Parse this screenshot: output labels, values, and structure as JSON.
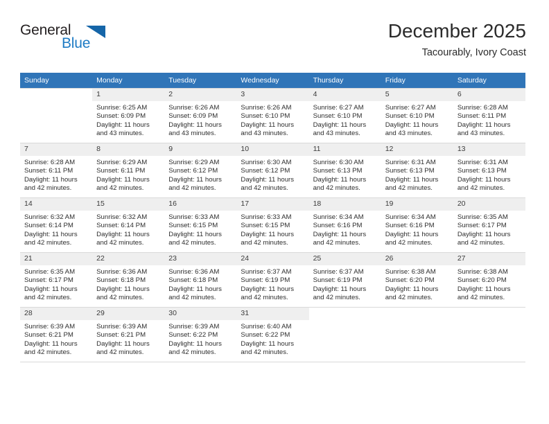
{
  "brand": {
    "name_top": "General",
    "name_bottom": "Blue",
    "accent_color": "#1e7bc4",
    "triangle_color": "#1565a8"
  },
  "header": {
    "month_title": "December 2025",
    "location": "Tacourably, Ivory Coast"
  },
  "calendar": {
    "header_color": "#3075b8",
    "daynum_band_color": "#efefef",
    "weekday_headers": [
      "Sunday",
      "Monday",
      "Tuesday",
      "Wednesday",
      "Thursday",
      "Friday",
      "Saturday"
    ],
    "weeks": [
      [
        {
          "day": "",
          "blank": true,
          "lines": []
        },
        {
          "day": "1",
          "lines": [
            "Sunrise: 6:25 AM",
            "Sunset: 6:09 PM",
            "Daylight: 11 hours",
            "and 43 minutes."
          ]
        },
        {
          "day": "2",
          "lines": [
            "Sunrise: 6:26 AM",
            "Sunset: 6:09 PM",
            "Daylight: 11 hours",
            "and 43 minutes."
          ]
        },
        {
          "day": "3",
          "lines": [
            "Sunrise: 6:26 AM",
            "Sunset: 6:10 PM",
            "Daylight: 11 hours",
            "and 43 minutes."
          ]
        },
        {
          "day": "4",
          "lines": [
            "Sunrise: 6:27 AM",
            "Sunset: 6:10 PM",
            "Daylight: 11 hours",
            "and 43 minutes."
          ]
        },
        {
          "day": "5",
          "lines": [
            "Sunrise: 6:27 AM",
            "Sunset: 6:10 PM",
            "Daylight: 11 hours",
            "and 43 minutes."
          ]
        },
        {
          "day": "6",
          "lines": [
            "Sunrise: 6:28 AM",
            "Sunset: 6:11 PM",
            "Daylight: 11 hours",
            "and 43 minutes."
          ]
        }
      ],
      [
        {
          "day": "7",
          "lines": [
            "Sunrise: 6:28 AM",
            "Sunset: 6:11 PM",
            "Daylight: 11 hours",
            "and 42 minutes."
          ]
        },
        {
          "day": "8",
          "lines": [
            "Sunrise: 6:29 AM",
            "Sunset: 6:11 PM",
            "Daylight: 11 hours",
            "and 42 minutes."
          ]
        },
        {
          "day": "9",
          "lines": [
            "Sunrise: 6:29 AM",
            "Sunset: 6:12 PM",
            "Daylight: 11 hours",
            "and 42 minutes."
          ]
        },
        {
          "day": "10",
          "lines": [
            "Sunrise: 6:30 AM",
            "Sunset: 6:12 PM",
            "Daylight: 11 hours",
            "and 42 minutes."
          ]
        },
        {
          "day": "11",
          "lines": [
            "Sunrise: 6:30 AM",
            "Sunset: 6:13 PM",
            "Daylight: 11 hours",
            "and 42 minutes."
          ]
        },
        {
          "day": "12",
          "lines": [
            "Sunrise: 6:31 AM",
            "Sunset: 6:13 PM",
            "Daylight: 11 hours",
            "and 42 minutes."
          ]
        },
        {
          "day": "13",
          "lines": [
            "Sunrise: 6:31 AM",
            "Sunset: 6:13 PM",
            "Daylight: 11 hours",
            "and 42 minutes."
          ]
        }
      ],
      [
        {
          "day": "14",
          "lines": [
            "Sunrise: 6:32 AM",
            "Sunset: 6:14 PM",
            "Daylight: 11 hours",
            "and 42 minutes."
          ]
        },
        {
          "day": "15",
          "lines": [
            "Sunrise: 6:32 AM",
            "Sunset: 6:14 PM",
            "Daylight: 11 hours",
            "and 42 minutes."
          ]
        },
        {
          "day": "16",
          "lines": [
            "Sunrise: 6:33 AM",
            "Sunset: 6:15 PM",
            "Daylight: 11 hours",
            "and 42 minutes."
          ]
        },
        {
          "day": "17",
          "lines": [
            "Sunrise: 6:33 AM",
            "Sunset: 6:15 PM",
            "Daylight: 11 hours",
            "and 42 minutes."
          ]
        },
        {
          "day": "18",
          "lines": [
            "Sunrise: 6:34 AM",
            "Sunset: 6:16 PM",
            "Daylight: 11 hours",
            "and 42 minutes."
          ]
        },
        {
          "day": "19",
          "lines": [
            "Sunrise: 6:34 AM",
            "Sunset: 6:16 PM",
            "Daylight: 11 hours",
            "and 42 minutes."
          ]
        },
        {
          "day": "20",
          "lines": [
            "Sunrise: 6:35 AM",
            "Sunset: 6:17 PM",
            "Daylight: 11 hours",
            "and 42 minutes."
          ]
        }
      ],
      [
        {
          "day": "21",
          "lines": [
            "Sunrise: 6:35 AM",
            "Sunset: 6:17 PM",
            "Daylight: 11 hours",
            "and 42 minutes."
          ]
        },
        {
          "day": "22",
          "lines": [
            "Sunrise: 6:36 AM",
            "Sunset: 6:18 PM",
            "Daylight: 11 hours",
            "and 42 minutes."
          ]
        },
        {
          "day": "23",
          "lines": [
            "Sunrise: 6:36 AM",
            "Sunset: 6:18 PM",
            "Daylight: 11 hours",
            "and 42 minutes."
          ]
        },
        {
          "day": "24",
          "lines": [
            "Sunrise: 6:37 AM",
            "Sunset: 6:19 PM",
            "Daylight: 11 hours",
            "and 42 minutes."
          ]
        },
        {
          "day": "25",
          "lines": [
            "Sunrise: 6:37 AM",
            "Sunset: 6:19 PM",
            "Daylight: 11 hours",
            "and 42 minutes."
          ]
        },
        {
          "day": "26",
          "lines": [
            "Sunrise: 6:38 AM",
            "Sunset: 6:20 PM",
            "Daylight: 11 hours",
            "and 42 minutes."
          ]
        },
        {
          "day": "27",
          "lines": [
            "Sunrise: 6:38 AM",
            "Sunset: 6:20 PM",
            "Daylight: 11 hours",
            "and 42 minutes."
          ]
        }
      ],
      [
        {
          "day": "28",
          "lines": [
            "Sunrise: 6:39 AM",
            "Sunset: 6:21 PM",
            "Daylight: 11 hours",
            "and 42 minutes."
          ]
        },
        {
          "day": "29",
          "lines": [
            "Sunrise: 6:39 AM",
            "Sunset: 6:21 PM",
            "Daylight: 11 hours",
            "and 42 minutes."
          ]
        },
        {
          "day": "30",
          "lines": [
            "Sunrise: 6:39 AM",
            "Sunset: 6:22 PM",
            "Daylight: 11 hours",
            "and 42 minutes."
          ]
        },
        {
          "day": "31",
          "lines": [
            "Sunrise: 6:40 AM",
            "Sunset: 6:22 PM",
            "Daylight: 11 hours",
            "and 42 minutes."
          ]
        },
        {
          "day": "",
          "blank": true,
          "lines": []
        },
        {
          "day": "",
          "blank": true,
          "lines": []
        },
        {
          "day": "",
          "blank": true,
          "lines": []
        }
      ]
    ]
  }
}
